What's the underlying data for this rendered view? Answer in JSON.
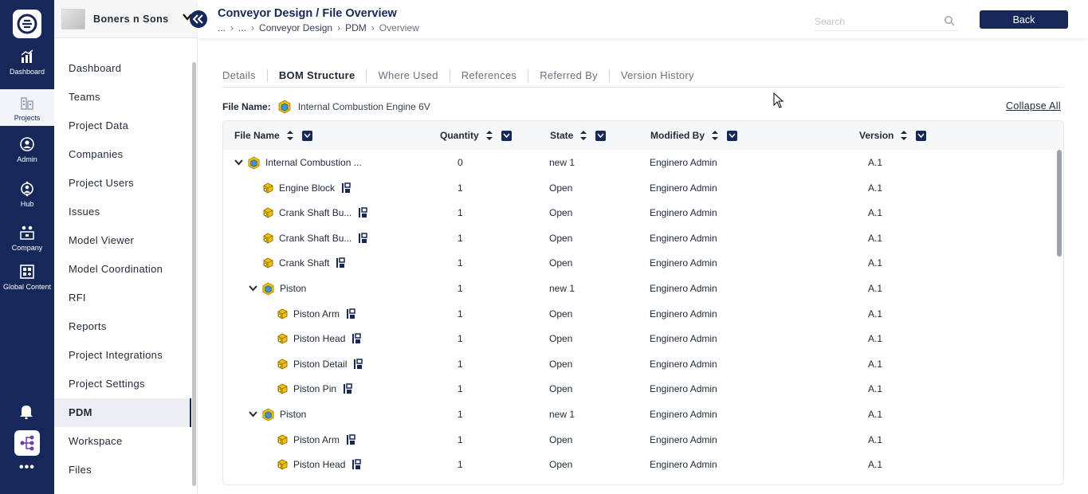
{
  "rail": {
    "items": [
      {
        "label": "Dashboard",
        "icon": "chart-icon"
      },
      {
        "label": "Projects",
        "icon": "building-icon"
      },
      {
        "label": "Admin",
        "icon": "admin-icon"
      },
      {
        "label": "Hub",
        "icon": "hub-icon"
      },
      {
        "label": "Company",
        "icon": "company-icon"
      },
      {
        "label": "Global Content",
        "icon": "global-content-icon"
      }
    ]
  },
  "sidebar": {
    "company_name": "Boners n Sons",
    "items": [
      {
        "label": "Dashboard"
      },
      {
        "label": "Teams"
      },
      {
        "label": "Project Data"
      },
      {
        "label": "Companies"
      },
      {
        "label": "Project Users"
      },
      {
        "label": "Issues"
      },
      {
        "label": "Model Viewer"
      },
      {
        "label": "Model Coordination"
      },
      {
        "label": "RFI"
      },
      {
        "label": "Reports"
      },
      {
        "label": "Project Integrations"
      },
      {
        "label": "Project Settings"
      },
      {
        "label": "PDM"
      },
      {
        "label": "Workspace"
      },
      {
        "label": "Files"
      }
    ],
    "active": "PDM"
  },
  "header": {
    "title": "Conveyor Design / File Overview",
    "breadcrumbs": [
      "...",
      "...",
      "Conveyor Design",
      "PDM",
      "Overview"
    ],
    "search_placeholder": "Search",
    "back_label": "Back"
  },
  "tabs": [
    {
      "label": "Details",
      "active": false
    },
    {
      "label": "BOM Structure",
      "active": true
    },
    {
      "label": "Where Used",
      "active": false
    },
    {
      "label": "References",
      "active": false
    },
    {
      "label": "Referred By",
      "active": false
    },
    {
      "label": "Version History",
      "active": false
    }
  ],
  "file": {
    "label": "File Name:",
    "name": "Internal Combustion Engine 6V",
    "collapse_all": "Collapse All"
  },
  "table": {
    "columns": [
      "File Name",
      "Quantity",
      "State",
      "Modified By",
      "Version"
    ],
    "rows": [
      {
        "name": "Internal Combustion ...",
        "level": 0,
        "expanded": true,
        "type": "assembly",
        "qty": "0",
        "state": "new 1",
        "modified_by": "Enginero Admin",
        "version": "A.1"
      },
      {
        "name": "Engine Block",
        "level": 1,
        "type": "part",
        "qty": "1",
        "state": "Open",
        "modified_by": "Enginero Admin",
        "version": "A.1"
      },
      {
        "name": "Crank Shaft Bu...",
        "level": 1,
        "type": "part",
        "qty": "1",
        "state": "Open",
        "modified_by": "Enginero Admin",
        "version": "A.1"
      },
      {
        "name": "Crank Shaft Bu...",
        "level": 1,
        "type": "part",
        "qty": "1",
        "state": "Open",
        "modified_by": "Enginero Admin",
        "version": "A.1"
      },
      {
        "name": "Crank Shaft",
        "level": 1,
        "type": "part",
        "qty": "1",
        "state": "Open",
        "modified_by": "Enginero Admin",
        "version": "A.1"
      },
      {
        "name": "Piston",
        "level": 1,
        "expanded": true,
        "type": "assembly",
        "qty": "1",
        "state": "new 1",
        "modified_by": "Enginero Admin",
        "version": "A.1"
      },
      {
        "name": "Piston Arm",
        "level": 2,
        "type": "part",
        "qty": "1",
        "state": "Open",
        "modified_by": "Enginero Admin",
        "version": "A.1"
      },
      {
        "name": "Piston Head",
        "level": 2,
        "type": "part",
        "qty": "1",
        "state": "Open",
        "modified_by": "Enginero Admin",
        "version": "A.1"
      },
      {
        "name": "Piston Detail",
        "level": 2,
        "type": "part",
        "qty": "1",
        "state": "Open",
        "modified_by": "Enginero Admin",
        "version": "A.1"
      },
      {
        "name": "Piston Pin",
        "level": 2,
        "type": "part",
        "qty": "1",
        "state": "Open",
        "modified_by": "Enginero Admin",
        "version": "A.1"
      },
      {
        "name": "Piston",
        "level": 1,
        "expanded": true,
        "type": "assembly",
        "qty": "1",
        "state": "new 1",
        "modified_by": "Enginero Admin",
        "version": "A.1"
      },
      {
        "name": "Piston Arm",
        "level": 2,
        "type": "part",
        "qty": "1",
        "state": "Open",
        "modified_by": "Enginero Admin",
        "version": "A.1"
      },
      {
        "name": "Piston Head",
        "level": 2,
        "type": "part",
        "qty": "1",
        "state": "Open",
        "modified_by": "Enginero Admin",
        "version": "A.1"
      }
    ]
  },
  "colors": {
    "navy": "#16285a",
    "part_yellow": "#f2c200",
    "assembly_blue": "#4a90c8"
  }
}
